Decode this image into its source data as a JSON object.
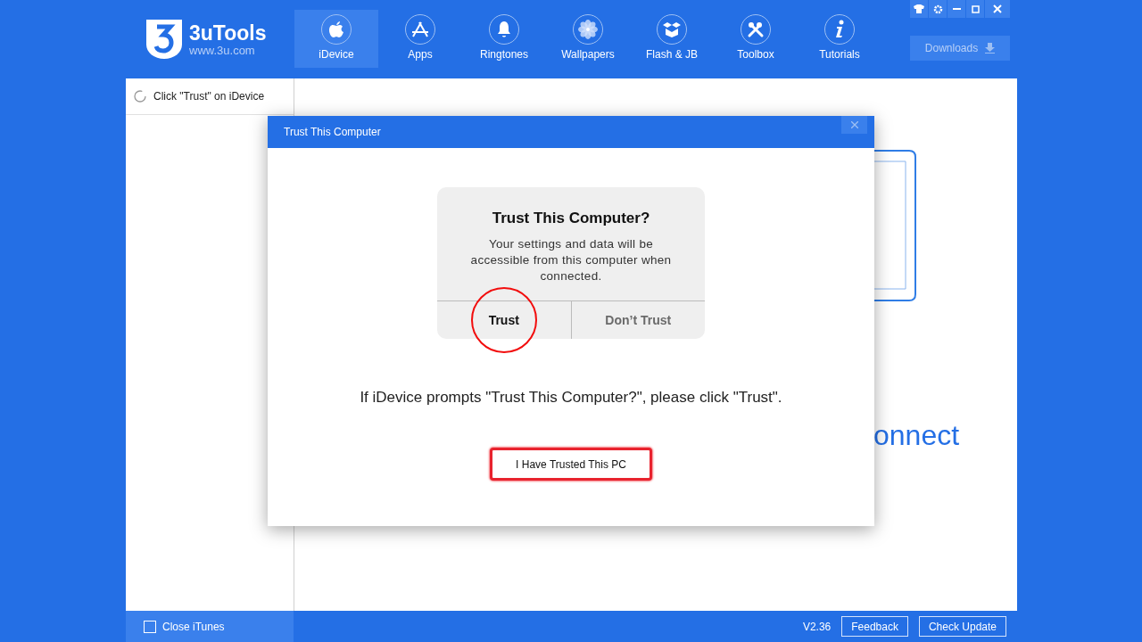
{
  "app": {
    "name": "3uTools",
    "url": "www.3u.com"
  },
  "nav": [
    {
      "label": "iDevice",
      "selected": true
    },
    {
      "label": "Apps",
      "selected": false
    },
    {
      "label": "Ringtones",
      "selected": false
    },
    {
      "label": "Wallpapers",
      "selected": false
    },
    {
      "label": "Flash & JB",
      "selected": false
    },
    {
      "label": "Toolbox",
      "selected": false
    },
    {
      "label": "Tutorials",
      "selected": false
    }
  ],
  "downloads": {
    "label": "Downloads"
  },
  "sidebar": {
    "items": [
      {
        "label": "Click \"Trust\" on iDevice"
      }
    ]
  },
  "main": {
    "text": "onnect"
  },
  "dialog": {
    "title": "Trust This Computer",
    "alert": {
      "title": "Trust This Computer?",
      "message": "Your settings and data will be accessible from this computer when connected.",
      "buttons": [
        {
          "label": "Trust",
          "circled": true
        },
        {
          "label": "Don’t Trust",
          "circled": false
        }
      ]
    },
    "instruction": "If iDevice prompts \"Trust This Computer?\", please click \"Trust\".",
    "confirm_button": "I Have Trusted This PC"
  },
  "status_bar": {
    "close_itunes": {
      "label": "Close iTunes",
      "checked": false
    },
    "version": "V2.36",
    "buttons": [
      "Feedback",
      "Check Update"
    ]
  }
}
